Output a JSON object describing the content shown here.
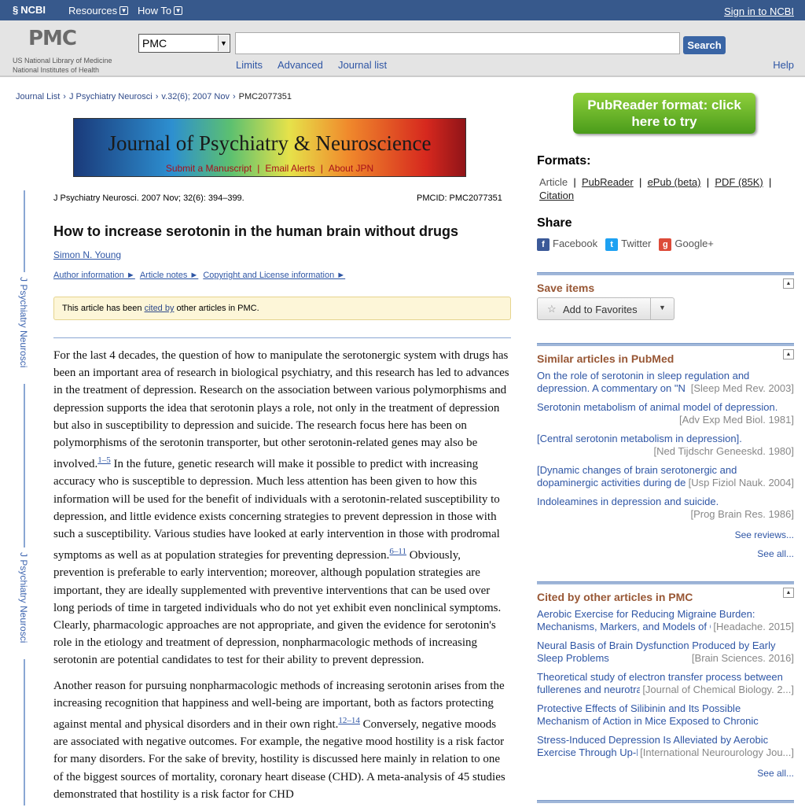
{
  "topbar": {
    "ncbi": "NCBI",
    "resources": "Resources",
    "howto": "How To",
    "signin": "Sign in to NCBI"
  },
  "search": {
    "logo": "PMC",
    "org1": "US National Library of Medicine",
    "org2": "National Institutes of Health",
    "db": "PMC",
    "term_value": "",
    "button": "Search",
    "limits": "Limits",
    "advanced": "Advanced",
    "journal_list": "Journal list",
    "help": "Help"
  },
  "breadcrumb": [
    "Journal List",
    "J Psychiatry Neurosci",
    "v.32(6); 2007 Nov",
    "PMC2077351"
  ],
  "banner": {
    "journal": "Journal of Psychiatry & Neuroscience",
    "links": [
      "Submit a Manuscript",
      "Email Alerts",
      "About JPN"
    ]
  },
  "side_label": "J Psychiatry Neurosci",
  "article": {
    "citation": "J Psychiatry Neurosci. 2007 Nov; 32(6): 394–399.",
    "pmcid": "PMCID: PMC2077351",
    "title": "How to increase serotonin in the human brain without drugs",
    "author": "Simon N. Young",
    "info_links": [
      "Author information ►",
      "Article notes ►",
      "Copyright and License information ►"
    ],
    "cited_pre": "This article has been ",
    "cited_link": "cited by",
    "cited_post": " other articles in PMC.",
    "p1a": "For the last 4 decades, the question of how to manipulate the serotonergic system with drugs has been an important area of research in biological psychiatry, and this research has led to advances in the treatment of depression. Research on the association between various polymorphisms and depression supports the idea that serotonin plays a role, not only in the treatment of depression but also in susceptibility to depression and suicide. The research focus here has been on polymorphisms of the serotonin transporter, but other serotonin-related genes may also be involved.",
    "ref1": "1–5",
    "p1b": " In the future, genetic research will make it possible to predict with increasing accuracy who is susceptible to depression. Much less attention has been given to how this information will be used for the benefit of individuals with a serotonin-related susceptibility to depression, and little evidence exists concerning strategies to prevent depression in those with such a susceptibility. Various studies have looked at early intervention in those with prodromal symptoms as well as at population strategies for preventing depression.",
    "ref2": "6–11",
    "p1c": " Obviously, prevention is preferable to early intervention; moreover, although population strategies are important, they are ideally supplemented with preventive interventions that can be used over long periods of time in targeted individuals who do not yet exhibit even nonclinical symptoms. Clearly, pharmacologic approaches are not appropriate, and given the evidence for serotonin's role in the etiology and treatment of depression, nonpharmacologic methods of increasing serotonin are potential candidates to test for their ability to prevent depression.",
    "p2a": "Another reason for pursuing nonpharmacologic methods of increasing serotonin arises from the increasing recognition that happiness and well-being are important, both as factors protecting against mental and physical disorders and in their own right.",
    "ref3": "12–14",
    "p2b": " Conversely, negative moods are associated with negative outcomes. For example, the negative mood hostility is a risk factor for many disorders. For the sake of brevity, hostility is discussed here mainly in relation to one of the biggest sources of mortality, coronary heart disease (CHD). A meta-analysis of 45 studies demonstrated that hostility is a risk factor for CHD"
  },
  "sidebar": {
    "pubreader": "PubReader format: click here to try",
    "formats_title": "Formats:",
    "formats": [
      "Article",
      "PubReader",
      "ePub (beta)",
      "PDF (85K)",
      "Citation"
    ],
    "share_title": "Share",
    "share": [
      "Facebook",
      "Twitter",
      "Google+"
    ],
    "save_title": "Save items",
    "add_fav": "Add to Favorites",
    "similar_title": "Similar articles in PubMed",
    "similar": [
      {
        "title": "On the role of serotonin in sleep regulation and depression. A commentary on \"N",
        "source": "[Sleep Med Rev. 2003]"
      },
      {
        "title": "Serotonin metabolism of animal model of depression.",
        "source": "[Adv Exp Med Biol. 1981]"
      },
      {
        "title": "[Central serotonin metabolism in depression].",
        "source": "[Ned Tijdschr Geneeskd. 1980]"
      },
      {
        "title": "[Dynamic changes of brain serotonergic and dopaminergic activities during de",
        "source": "[Usp Fiziol Nauk. 2004]"
      },
      {
        "title": "Indoleamines in depression and suicide.",
        "source": "[Prog Brain Res. 1986]"
      }
    ],
    "see_reviews": "See reviews...",
    "see_all": "See all...",
    "cited_title": "Cited by other articles in PMC",
    "cited": [
      {
        "title": "Aerobic Exercise for Reducing Migraine Burden: Mechanisms, Markers, and Models of C",
        "source": "[Headache. 2015]"
      },
      {
        "title": "Neural Basis of Brain Dysfunction Produced by Early Sleep Problems",
        "source": "[Brain Sciences. 2016]"
      },
      {
        "title": "Theoretical study of electron transfer process between fullerenes and neurotra",
        "source": "[Journal of Chemical Biology. 2...]"
      },
      {
        "title": "Protective Effects of Silibinin and Its Possible Mechanism of Action in Mice Exposed to Chronic",
        "source": ""
      },
      {
        "title": "Stress-Induced Depression Is Alleviated by Aerobic Exercise Through Up-R",
        "source": "[International Neurourology Jou...]"
      }
    ],
    "see_all2": "See all..."
  }
}
